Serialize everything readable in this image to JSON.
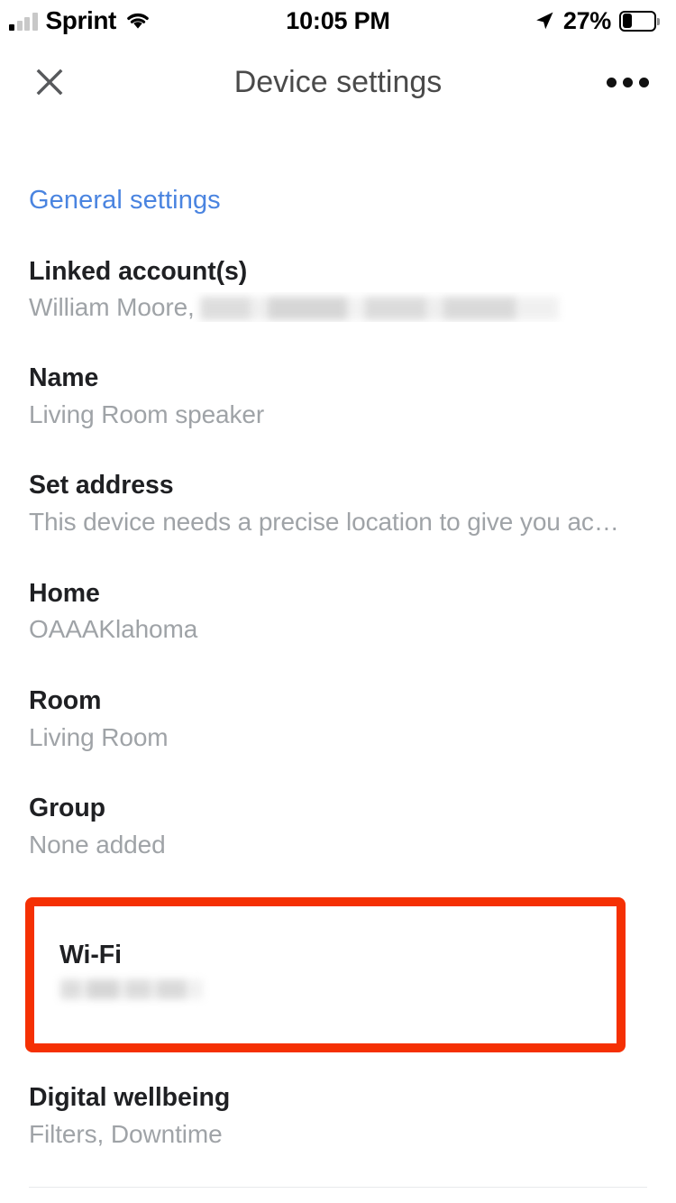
{
  "status_bar": {
    "carrier": "Sprint",
    "signal_icon": "cellular-signal-icon",
    "signal_bars_filled": 1,
    "signal_bars_total": 4,
    "wifi_icon": "wifi-icon",
    "time": "10:05 PM",
    "location_icon": "location-arrow-icon",
    "battery_percent": "27%",
    "battery_level": 27,
    "battery_icon": "battery-icon"
  },
  "app_bar": {
    "close_icon": "close-icon",
    "title": "Device settings",
    "more_icon": "more-horizontal-icon"
  },
  "main": {
    "section_title": "General settings",
    "rows": [
      {
        "title": "Linked account(s)",
        "subtitle": "William Moore,",
        "redacted": true
      },
      {
        "title": "Name",
        "subtitle": "Living Room speaker",
        "redacted": false
      },
      {
        "title": "Set address",
        "subtitle": "This device needs a precise location to give you ac…",
        "redacted": false
      },
      {
        "title": "Home",
        "subtitle": "OAAAKlahoma",
        "redacted": false
      },
      {
        "title": "Room",
        "subtitle": "Living Room",
        "redacted": false
      },
      {
        "title": "Group",
        "subtitle": "None added",
        "redacted": false
      }
    ],
    "highlighted_row": {
      "title": "Wi-Fi",
      "subtitle": "",
      "redacted": true,
      "highlight_color": "#f53003"
    },
    "last_row": {
      "title": "Digital wellbeing",
      "subtitle": "Filters, Downtime"
    }
  },
  "colors": {
    "accent_blue": "#4a84e0",
    "primary_text": "#1f2023",
    "secondary_text": "#9fa3a7",
    "highlight_red": "#f53003",
    "background": "#ffffff"
  }
}
